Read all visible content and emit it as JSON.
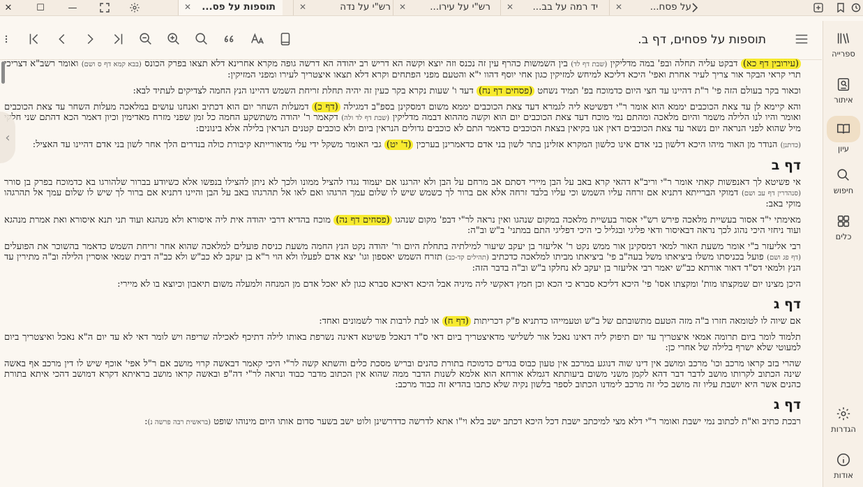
{
  "tabs": [
    {
      "label": "תוספות על פס...",
      "active": true
    },
    {
      "label": "רש\"י על נדה",
      "active": false
    },
    {
      "label": "רש\"י על עירו...",
      "active": false
    },
    {
      "label": "יד רמה על בב...",
      "active": false
    },
    {
      "label": "על פסח...",
      "active": false
    }
  ],
  "toolbar": {
    "title": "תוספות על פסחים, דף ב."
  },
  "sidebar": [
    {
      "label": "ספרייה"
    },
    {
      "label": "איתור"
    },
    {
      "label": "עיון",
      "active": true
    },
    {
      "label": "חיפוש"
    },
    {
      "label": "כלים"
    },
    {
      "label": "הגדרות"
    },
    {
      "label": "אודות"
    }
  ],
  "content": {
    "p1": {
      "hl": "(עירובין דף כא)",
      "t1": " דבקט עליה תחלה ובפ' במה מדליקין ",
      "s1": "(שבת דף לד)",
      "t2": " בין השמשות כהרף עין זה נכנס וזה יוצא וקשה הא דריש רב יהודה הא דרשה גופה מקרא אחרינא דלא תצאו בפרק הכונס ",
      "s2": "(בבא קמא דף ס ושם)",
      "t3": " ואומר רשב\"א דצריכי תרי קראי הבקר אור צריך לעיר אחרת ואפי' היכא דליכא למיחש למזיקין כגון אחי יוסף דהוו י\"א והטעם מפני הפתחים וקרא דלא תצאו איצטריך לעירו ומפני המזיקין:"
    },
    "p2": {
      "t1": "וכאור בקר בעולם הזה פי' ר\"ת דהיינו עד חצי היום כדמוכח בפ' תמיד נשחט ",
      "hl": "(פסחים דף נח)",
      "t2": " דעד ו' שעות נקרא בקר כעין זה יהיה תחלת זריחת השמש דהיינו הנץ החמה לצדיקים לעתיד לבא:"
    },
    "p3": {
      "t1": "והא קיימא לן עד צאת הכוכבים יממא הוא אומר ר\"י דפשיטא ליה לגמרא דעד צאת הכוכבים יממא משום דמסקינן בספ\"ב דמגילה ",
      "hl": "(דף כ)",
      "t2": " דמעלות השחר יום הוא דכתיב ואנחנו עושים במלאכה מעלות השחר עד צאת הכוכבים ואומר והיו לנו הלילה משמר והיום מלאכה ומהתם נמי מוכח דעד צאת הכוכבים יום הוא וקשה מההוא דבמה מדליקין ",
      "s1": "(שבת דף לד ולה)",
      "t3": " דקאמר ר' יהודה משתשקע החמה כל זמן שפני מזרח מאדימין וכיון דאמר הכא דהתם שני חלקי מיל שהוא לפני הנראה יום נשאר עד צאת הכוכבים דאין אנו בקיאין בצאת הכוכבים כדאמר התם לא כוכבים גדולים הנראין ביום ולא כוכבים קטנים הנראין בלילה אלא בינונים:"
    },
    "p4": {
      "s1": "(כדתנן)",
      "t1": " הנודר מן האור מיהו היכא דלשון בני אדם אינו כלשון המקרא אזלינן בתר לשון בני אדם כדאמרינן בערכין ",
      "hl": "(ד' יט)",
      "t2": " גבי האומר משקל ידי עלי מדאורייתא קיבורת כולה בנדרים הלך אחר לשון בני אדם דהיינו עד האציל:"
    },
    "daf1": "דף ב",
    "p5": {
      "t1": "אי פשיטא לך דאנפשות קאתי אומר ר\"י וריב\"א דהאי קרא באב על הבן מיירי דסתם אב מרחם על הבן ולא יהרגנו אם יעמוד נגדו להציל ממונו ולכך לא ניתן להצילו בנפשו אלא כשיודע בברור שלהורגו בא כדמוכח בפרק בן סורר ",
      "s1": "(סנהדרין דף עב ושם)",
      "t2": " דמוקי הברייתא דתניא אם זרחה עליו השמש וכי עליו בלבד זרחה אלא אם ברור לך כשמש שיש לו שלום עמך הרגהו ואם לאו אל תהרגהו באב על הבן והיינו דתניא אם ברור לך שיש לו שלום עמך אל תהרגהו מוקי באב:"
    },
    "p6": {
      "t1": "מאימתי י\"ד אסור בעשיית מלאכה פירש רש\"י אסור בעשיית מלאכה במקום שנהגו ואין נראה לר\"י דבפ' מקום שנהגו ",
      "hl": "(פסחים דף נה)",
      "t2": " מוכח בהדיא דרבי יהודה אית ליה איסורא ולא מנהגא ועוד תני תנא איסורא ואת אמרת מנהגא ועוד ניחזי היכי נהוג לכך נראה דבאיסור ודאי פליגי ובגליל כי היכי דפליגי התם במתני' ב\"ש וב\"ה:"
    },
    "p7": {
      "t1": "רבי אליעזר ב\"י אומר משעת האור למאי דמסקינן אור ממש נקט ר' אליעזר בן יעקב שיעור למילתיה בתחלת היום ור' יהודה נקט הנץ החמה משעת כניסת פועלים למלאכה שהוא אחר זריחת השמש כדאמר בהשוכר את הפועלים ",
      "s1": "(דף פג ושם)",
      "t2": " פועל בכניסתו משלו ביציאתו משל בעה\"ב פי' ביציאתו מביתו למלאכה כדכתיב ",
      "s2": "(תהילים קד-כב)",
      "t3": " תזרח השמש יאספון וגו' יצא אדם לפעלו ולא הוי ר\"א בן יעקב לא כב\"ש ולא כב\"ה דבית שמאי אוסרין הלילה וב\"ה מתירין עד הנץ ולמאי דס\"ד דאור אורתא כב\"ש יאמר רבי אליעזר בן יעקב לא נחלקו ב\"ש וב\"ה בדבר הזה:"
    },
    "p8": {
      "t1": "היכן מצינו יום שמקצתו מות' ומקצתו אסו' פי' היכא דליכא סברא כי הכא וכן חמץ דאקשי ליה מיניה אבל היכא דאיכא סברא כגון לא יאכל אדם מן המנחה ולמעלה משום תיאבון וכיוצא בו לא מיירי:"
    },
    "daf2": "דף ג",
    "p9": {
      "t1": "אם שיוה לו לטומאה חזרו ב\"ה מזה הטעם מתשובתם של ב\"ש וטעמייהו כדתניא פ\"ק דכריתות ",
      "hl": "(דף ח)",
      "t2": " או לבת לרבות אור לשמונים ואחד:"
    },
    "p10": {
      "t1": "תלמוד לומר ביום תרומה אמאי איצטריך עד יום תיפוק ליה דאינו נאכל אור לשלישי מדאיצטריך ביום דאי ס\"ד דנאכל פשיטא דאינה נשרפת באותו לילה דתיכף לאכילה שריפה ויש לומר דאי לא עד יום ה\"א נאכל ואיצטריך ביום למעוטי שלא ישרף בלילה של אחרי כן:"
    },
    "p11": {
      "t1": "שהרי בזב קראו מרכב וכו' מרכב ומושב אין דינו שוה דנוגע במרכב אין טעון כבוס בגדים כדמוכח בתורת כהנים ובריש מסכת כלים והשתא קשה לר\"י היכי קאמר דבאשה קרוי מושב אם ר\"ל אפי' אוכף שיש לו דין מרכב אף באשה שינה הכתוב לקרותו מושב לדבר דבר דהא לקמן משני משום ביעותתא דגמלא אורחא הוא אלמא לשנות הדבר ממה שהוא אין הכתוב מדבר כבוד ונראה לר\"י דה\"פ ובאשה קראו מושב בראיתא דקרא דמושב דהכי איתא בתורת כהנים אשר היא יושבת עליו זה מושב כלי זה מרכב לימדנו הכתוב לספר בלשון נקיה שלא כתבו בהדיא זה כבוד מרכב:"
    },
    "daf3": "דף ג",
    "p12": {
      "t1": "רבכת כתיב וא\"ת לכתוב נמי ישבת ואומר ר\"י דלא מצי למיכתב ישבת דכל היכא דכתב ישב בלא וי\"ו אתא לדרשה כדדרשינן ולוט ישב בשער סדום אותו היום מינוהו שופט ",
      "s1": "(בראשית רבה פרשה נ)",
      "t2": ":"
    }
  }
}
